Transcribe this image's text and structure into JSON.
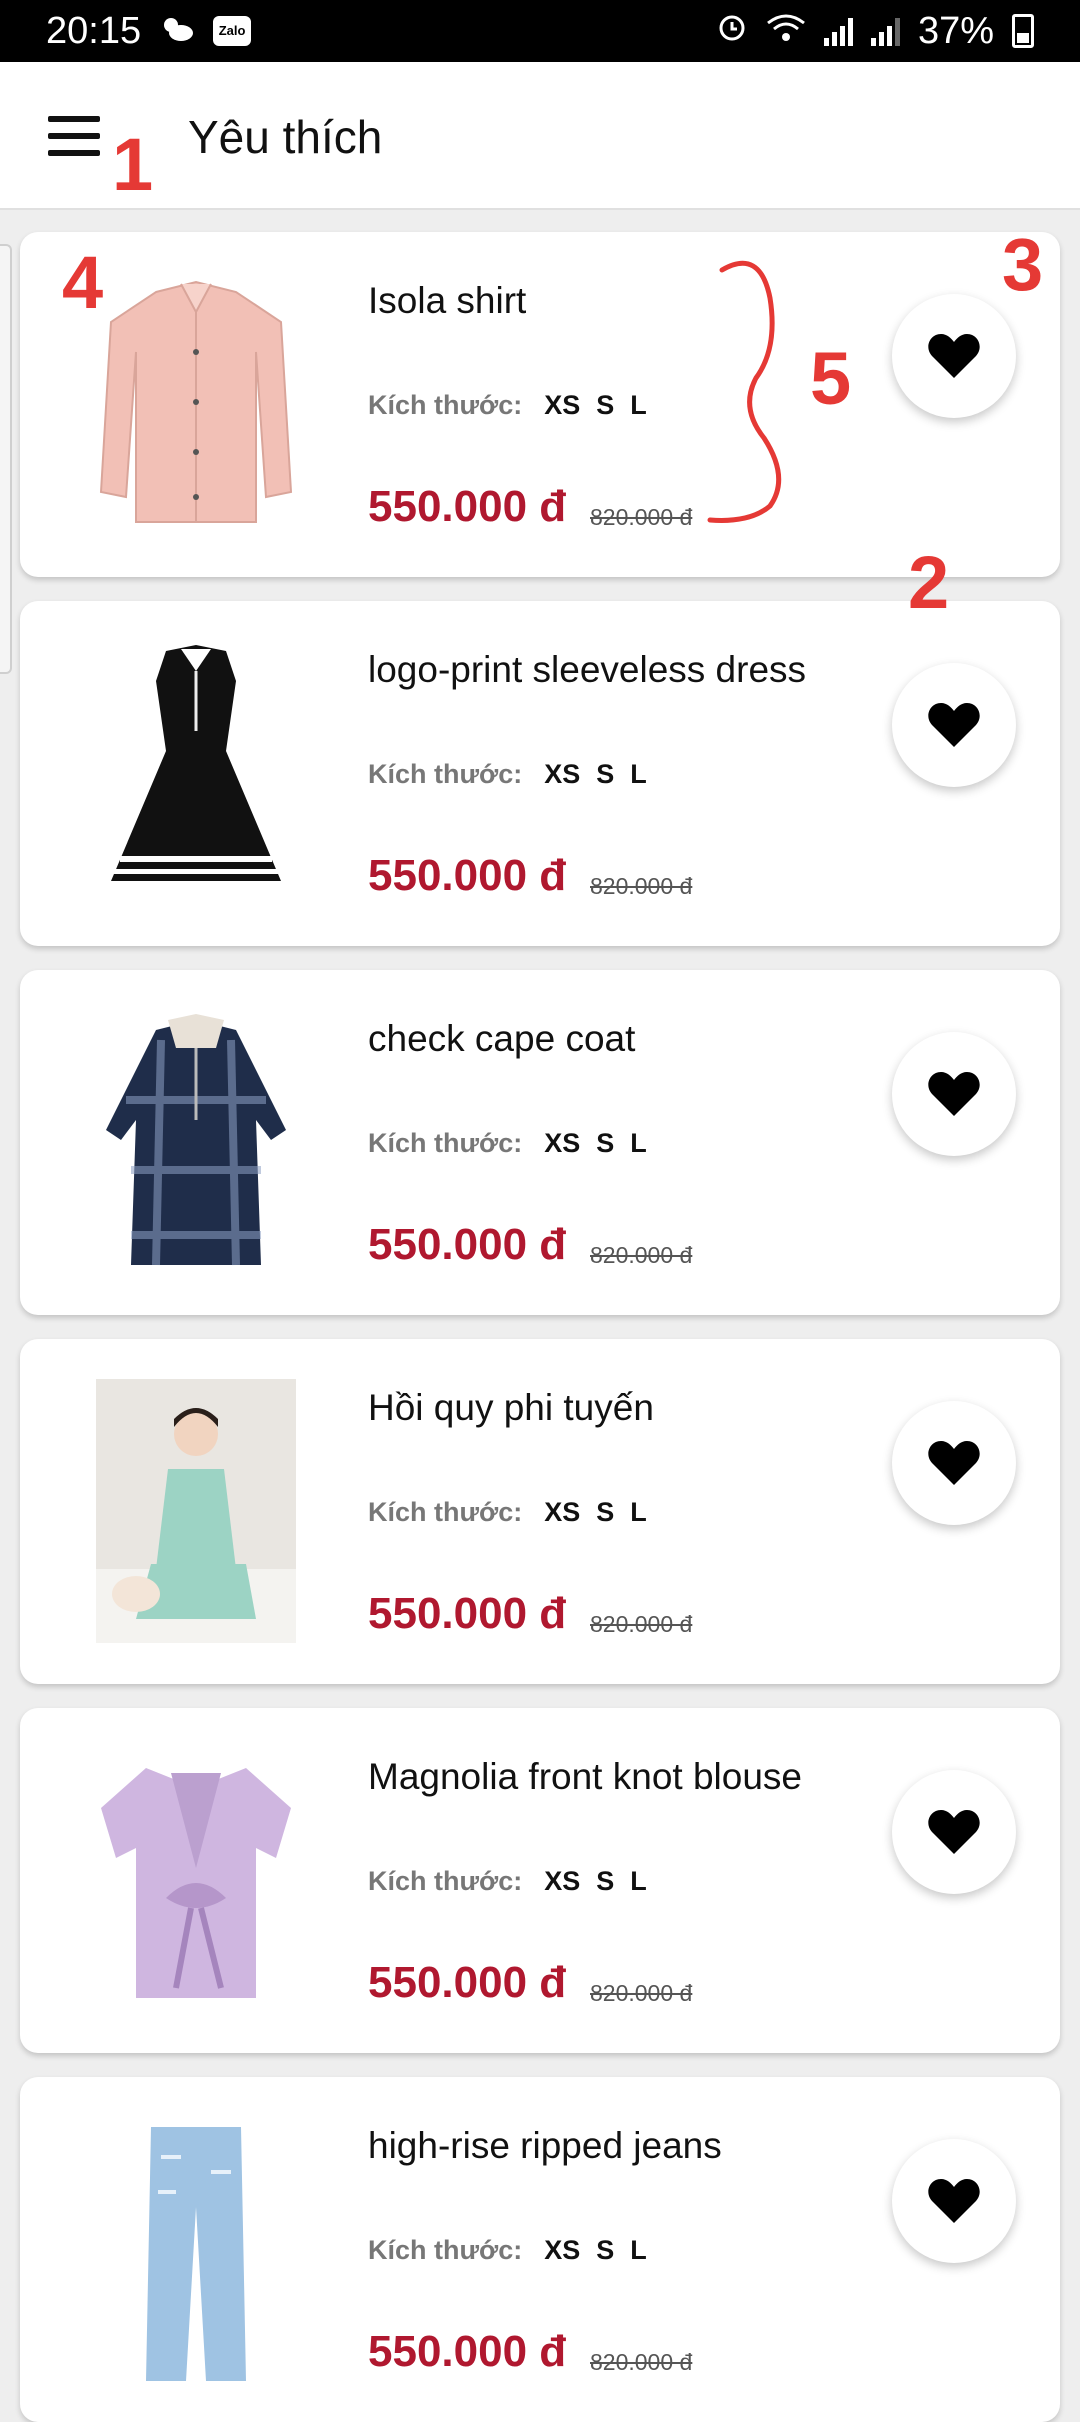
{
  "status_bar": {
    "time": "20:15",
    "weather_icon": "cloud-sun-icon",
    "app_badge": "Zalo",
    "battery_percent": "37%"
  },
  "header": {
    "title": "Yêu thích",
    "menu_icon": "hamburger-menu-icon"
  },
  "annotations": {
    "menu": "1",
    "favorite": "2",
    "favorite_first": "3",
    "image": "4",
    "details": "5"
  },
  "products": [
    {
      "name": "Isola shirt",
      "size_label": "Kích thước:",
      "sizes": [
        "XS",
        "S",
        "L"
      ],
      "price": "550.000 đ",
      "old_price": "820.000 đ",
      "image": "pink-shirt-image",
      "favorited": true
    },
    {
      "name": "logo-print sleeveless dress",
      "size_label": "Kích thước:",
      "sizes": [
        "XS",
        "S",
        "L"
      ],
      "price": "550.000 đ",
      "old_price": "820.000 đ",
      "image": "black-dress-image",
      "favorited": true
    },
    {
      "name": "check cape coat",
      "size_label": "Kích thước:",
      "sizes": [
        "XS",
        "S",
        "L"
      ],
      "price": "550.000 đ",
      "old_price": "820.000 đ",
      "image": "plaid-coat-image",
      "favorited": true
    },
    {
      "name": "Hồi quy phi tuyến",
      "size_label": "Kích thước:",
      "sizes": [
        "XS",
        "S",
        "L"
      ],
      "price": "550.000 đ",
      "old_price": "820.000 đ",
      "image": "model-photo-image",
      "favorited": true
    },
    {
      "name": "Magnolia front knot blouse",
      "size_label": "Kích thước:",
      "sizes": [
        "XS",
        "S",
        "L"
      ],
      "price": "550.000 đ",
      "old_price": "820.000 đ",
      "image": "lilac-blouse-image",
      "favorited": true
    },
    {
      "name": "high-rise ripped jeans",
      "size_label": "Kích thước:",
      "sizes": [
        "XS",
        "S",
        "L"
      ],
      "price": "550.000 đ",
      "old_price": "820.000 đ",
      "image": "jeans-image",
      "favorited": true
    }
  ],
  "colors": {
    "price": "#b0182f",
    "annotation": "#e53935",
    "heart": "#000000"
  }
}
